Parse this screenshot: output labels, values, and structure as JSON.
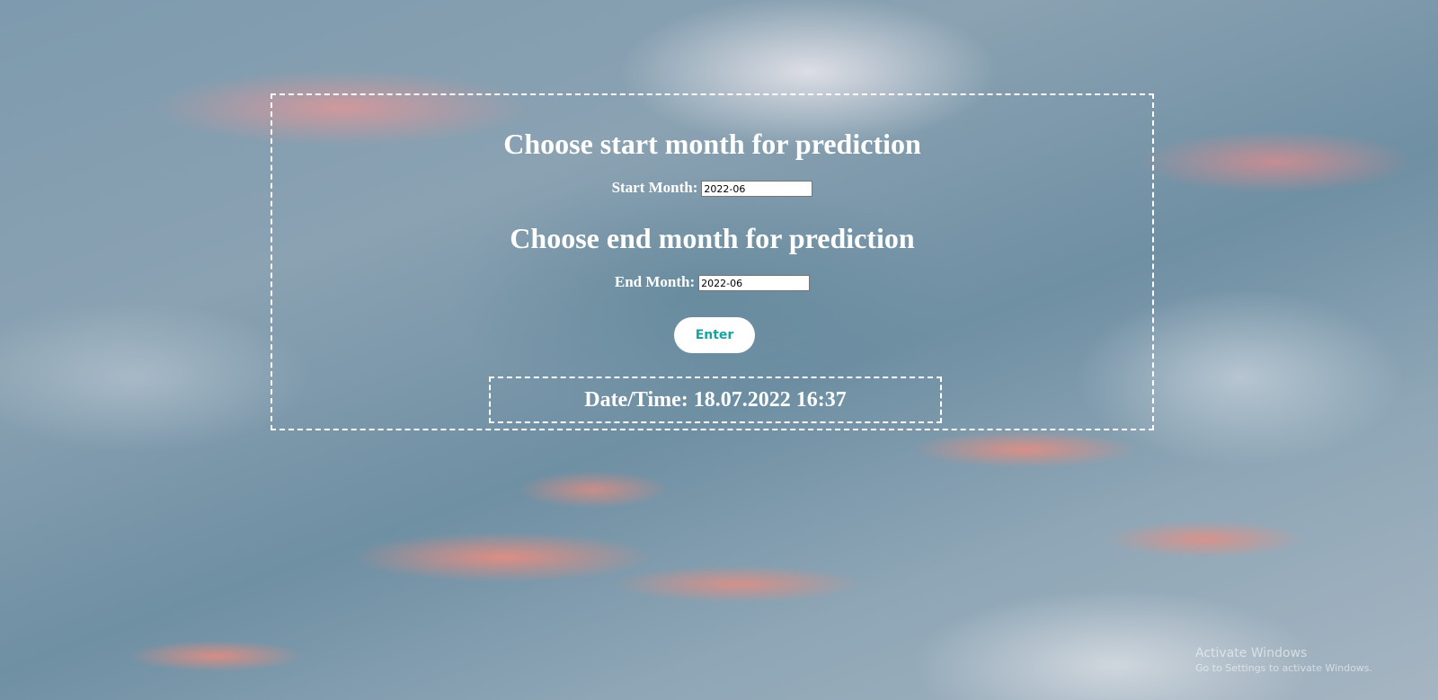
{
  "form": {
    "start_heading": "Choose start month for prediction",
    "start_label": "Start Month:",
    "start_value": "2022-06",
    "end_heading": "Choose end month for prediction",
    "end_label": "End Month:",
    "end_value": "2022-06",
    "enter_label": "Enter"
  },
  "datetime": {
    "text": "Date/Time: 18.07.2022 16:37"
  },
  "watermark": {
    "title": "Activate Windows",
    "subtitle": "Go to Settings to activate Windows."
  },
  "colors": {
    "panel_border": "#ffffff",
    "button_text": "#17a3a0",
    "heading_text": "#ffffff"
  }
}
